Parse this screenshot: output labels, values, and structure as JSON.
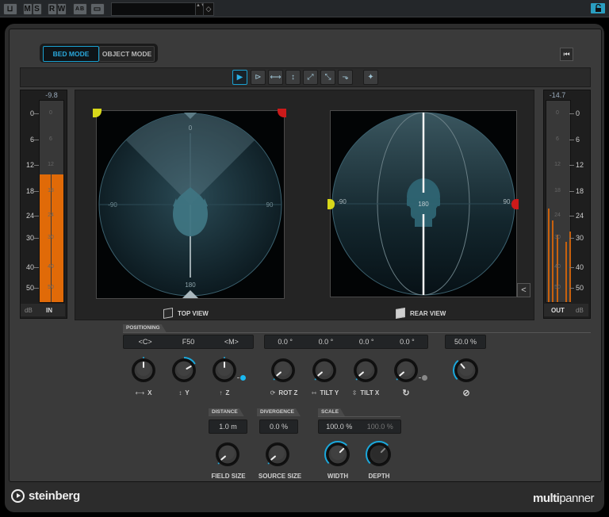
{
  "host_toolbar": {
    "buttons": [
      {
        "name": "bypass",
        "label": "⊔"
      },
      {
        "name": "mute",
        "label": "M"
      },
      {
        "name": "solo",
        "label": "S"
      },
      {
        "name": "read",
        "label": "R"
      },
      {
        "name": "write",
        "label": "W"
      },
      {
        "name": "compare",
        "label": "AB"
      },
      {
        "name": "store",
        "label": "▭"
      }
    ],
    "preset_name": "",
    "preset_arrows": "▲▼",
    "preset_menu_icon": "◇",
    "lock_state": "unlocked"
  },
  "mode": {
    "bed_mode_label": "BED MODE",
    "object_mode_label": "OBJECT MODE",
    "active": "BED MODE"
  },
  "collapse_icon": "⏮",
  "tools": [
    {
      "name": "select",
      "glyph": "▶",
      "active": true
    },
    {
      "name": "select-multi",
      "glyph": "⊳"
    },
    {
      "name": "move-horizontal",
      "glyph": "⟷"
    },
    {
      "name": "move-vertical",
      "glyph": "↕"
    },
    {
      "name": "move-diagonal-up",
      "glyph": "⤢"
    },
    {
      "name": "move-diagonal-down",
      "glyph": "⤡"
    },
    {
      "name": "pointer-snap",
      "glyph": "⬎"
    },
    {
      "name": "pointer-special",
      "glyph": "✦"
    }
  ],
  "input_meter": {
    "peak": "-9.8",
    "scale": [
      "0",
      "6",
      "12",
      "18",
      "24",
      "30",
      "40",
      "50"
    ],
    "level_db": 14,
    "footer_unit": "dB",
    "footer_label": "IN"
  },
  "output_meter": {
    "peak": "-14.7",
    "scale": [
      "0",
      "6",
      "12",
      "18",
      "24",
      "30",
      "40",
      "50"
    ],
    "channel_levels_db": [
      22,
      25,
      29,
      31,
      28
    ],
    "footer_label": "OUT",
    "footer_unit": "dB"
  },
  "top_view": {
    "label": "TOP VIEW",
    "angle_top": "0",
    "angle_bottom": "180",
    "angle_left": "-90",
    "angle_right": "90",
    "colors": {
      "left_corner": "#d8d81a",
      "right_corner": "#cc1a1a"
    }
  },
  "rear_view": {
    "label": "REAR VIEW",
    "angle_center": "180",
    "angle_left": "-90",
    "angle_right": "90",
    "back_icon": "<"
  },
  "positioning": {
    "section": "POSITIONING",
    "display": [
      "<C>",
      "F50",
      "<M>"
    ],
    "knobs": [
      {
        "name": "x",
        "label": "X",
        "icon": "⟷"
      },
      {
        "name": "y",
        "label": "Y",
        "icon": "↕"
      },
      {
        "name": "z",
        "label": "Z",
        "icon": "↑"
      }
    ]
  },
  "rotation": {
    "display": [
      "0.0 °",
      "0.0 °",
      "0.0 °",
      "0.0 °"
    ],
    "knobs": [
      {
        "name": "rot-z",
        "label": "ROT Z",
        "icon": "⟳"
      },
      {
        "name": "tilt-y",
        "label": "TILT Y",
        "icon": "⇿"
      },
      {
        "name": "tilt-x",
        "label": "TILT X",
        "icon": "⇳"
      },
      {
        "name": "rotate",
        "label": "",
        "icon": "↻"
      }
    ]
  },
  "center": {
    "display": "50.0 %",
    "icon": "⊘",
    "value_pct": 50
  },
  "distance": {
    "section": "DISTANCE",
    "display": "1.0 m",
    "knob_label": "FIELD SIZE"
  },
  "divergence": {
    "section": "DIVERGENCE",
    "display": "0.0 %",
    "knob_label": "SOURCE SIZE"
  },
  "scale": {
    "section": "SCALE",
    "width_display": "100.0 %",
    "depth_display": "100.0 %",
    "width_label": "WIDTH",
    "depth_label": "DEPTH"
  },
  "footer": {
    "brand": "steinberg",
    "product_bold": "multi",
    "product_rest": "panner"
  },
  "colors": {
    "accent": "#1aa8dc",
    "meter": "#e06a08"
  }
}
